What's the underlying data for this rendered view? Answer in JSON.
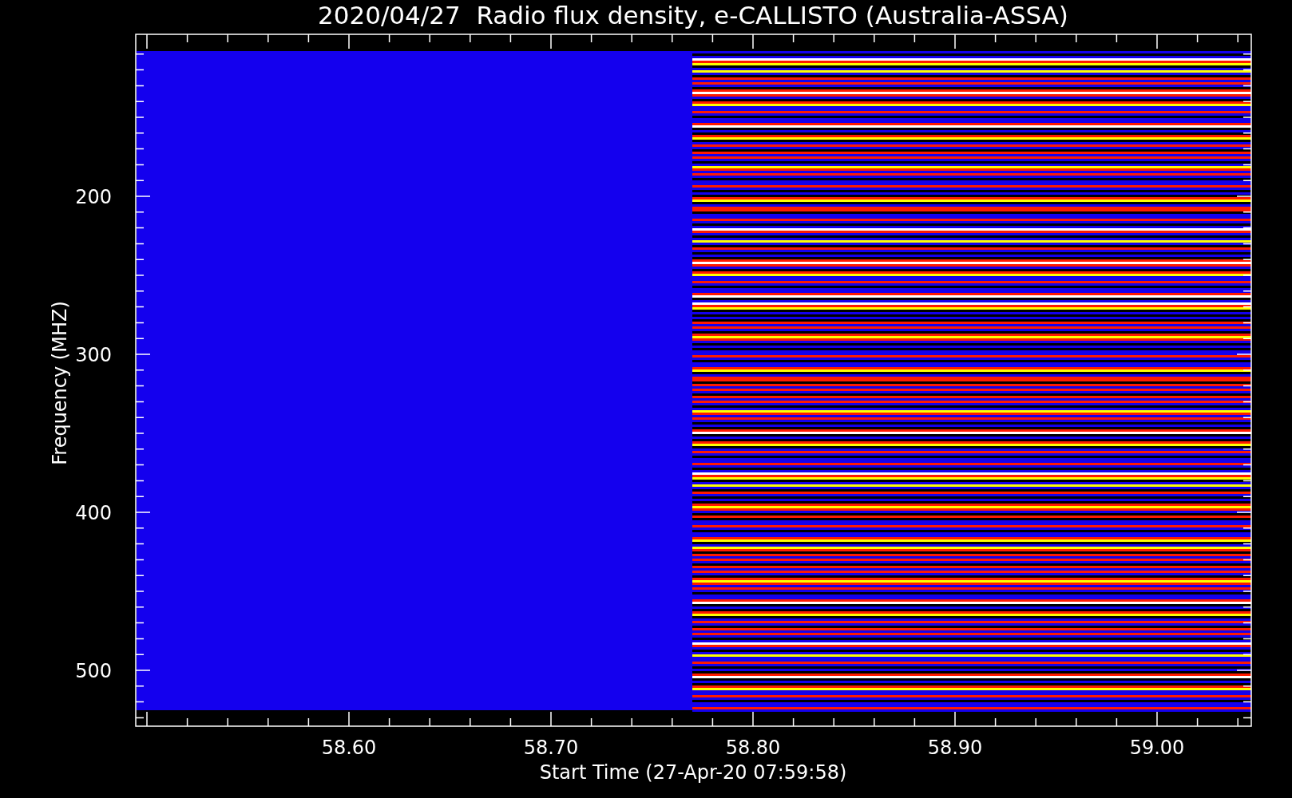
{
  "title": "2020/04/27  Radio flux density, e-CALLISTO (Australia-ASSA)",
  "y_axis": {
    "label": "Frequency (MHZ)",
    "ticks": [
      "200",
      "300",
      "400",
      "500"
    ]
  },
  "x_axis": {
    "label": "Start Time (27-Apr-20 07:59:58)",
    "ticks": [
      "58.60",
      "58.70",
      "58.80",
      "58.90",
      "59.00"
    ]
  }
}
